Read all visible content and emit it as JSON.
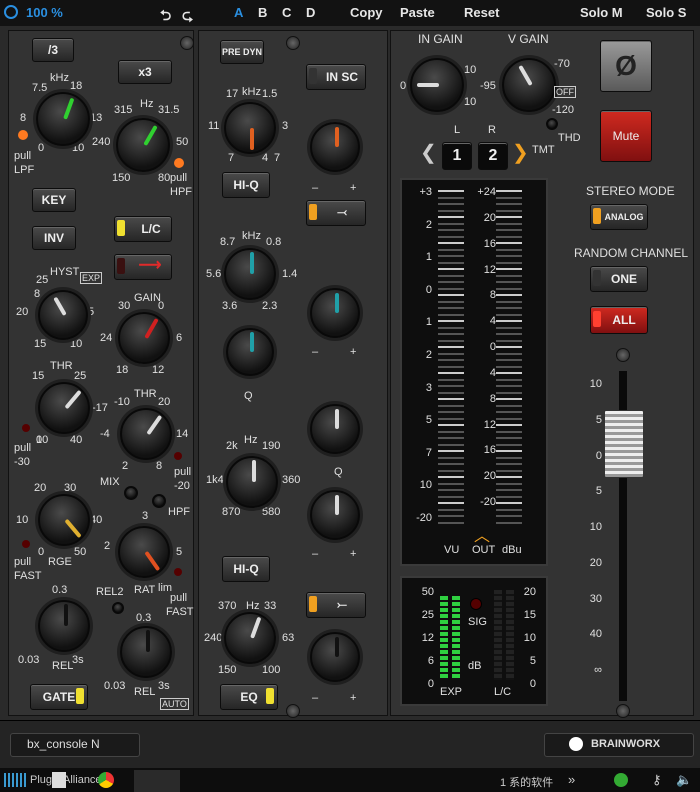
{
  "topbar": {
    "zoom": "100 %",
    "undo_icon": "undo-icon",
    "redo_icon": "redo-icon",
    "slot_a": "A",
    "slot_b": "B",
    "slot_c": "C",
    "slot_d": "D",
    "copy": "Copy",
    "paste": "Paste",
    "reset": "Reset",
    "solo_m": "Solo M",
    "solo_s": "Solo S"
  },
  "filter": {
    "div3": "/3",
    "x3": "x3",
    "lpf_unit": "kHz",
    "lpf_s1": "7.5",
    "lpf_s2": "18",
    "lpf_s3": "13",
    "lpf_s4": "8",
    "lpf_s5": "0",
    "lpf_s6": "10",
    "lpf_pull": "pull",
    "lpf_name": "LPF",
    "hpf_unit": "Hz",
    "hpf_s1": "315",
    "hpf_s2": "31.5",
    "hpf_s3": "240",
    "hpf_s4": "50",
    "hpf_s5": "150",
    "hpf_s6": "80",
    "hpf_pull": "pull",
    "hpf_name": "HPF"
  },
  "dyn": {
    "key": "KEY",
    "inv": "INV",
    "lc": "L/C",
    "hyst": "HYST",
    "exp": "EXP",
    "hyst_s": [
      "25",
      "8",
      "20",
      "5",
      "15",
      "10"
    ],
    "gain": "GAIN",
    "gain_s": [
      "30",
      "0",
      "24",
      "6",
      "18",
      "12"
    ],
    "thr1": "THR",
    "thr1_s": [
      "15",
      "25",
      "-17",
      "10",
      "0",
      "40"
    ],
    "thr1_pull": "pull",
    "thr1_val": "-30",
    "thr2": "THR",
    "thr2_s": [
      "-10",
      "20",
      "-4",
      "14",
      "2",
      "8"
    ],
    "thr2_pull": "pull",
    "thr2_val": "-20",
    "mix": "MIX",
    "hpf": "HPF",
    "rge": "RGE",
    "rge_s": [
      "20",
      "30",
      "10",
      "40",
      "0",
      "50"
    ],
    "rge_pull": "pull",
    "rge_fast": "FAST",
    "rat": "RAT",
    "rat_s": [
      "3",
      "2",
      "5",
      "lim"
    ],
    "rat_pull": "pull",
    "rat_fast": "FAST",
    "rel2": "REL2",
    "rel1": "REL",
    "rel1_s": [
      "0.3",
      "0.03",
      "3s"
    ],
    "rel2k": "REL",
    "rel2k_s": [
      "0.3",
      "0.03",
      "3s"
    ],
    "gate": "GATE",
    "auto": "AUTO"
  },
  "eq": {
    "pre_dyn": "PRE DYN",
    "in_sc": "IN SC",
    "hf_unit": "kHz",
    "hf_s": [
      "17",
      "1.5",
      "11",
      "3",
      "7",
      "4",
      "7"
    ],
    "hiq1": "HI-Q",
    "hmf_unit": "kHz",
    "hmf_s": [
      "8.7",
      "0.8",
      "5.6",
      "1.4",
      "3.6",
      "2.3"
    ],
    "q": "Q",
    "q2": "Q",
    "lmf_unit": "Hz",
    "lmf_s": [
      "2k",
      "190",
      "1k4",
      "360",
      "870",
      "580"
    ],
    "hiq2": "HI-Q",
    "lf_unit": "Hz",
    "lf_s": [
      "370",
      "33",
      "240",
      "63",
      "150",
      "100"
    ],
    "eq": "EQ",
    "minus": "–",
    "plus": "+"
  },
  "master": {
    "in_gain": "IN GAIN",
    "in_s": [
      "0",
      "10",
      "10"
    ],
    "v_gain": "V GAIN",
    "v_s": [
      "-70",
      "-95",
      "-120"
    ],
    "off": "OFF",
    "thd": "THD",
    "tmt": "TMT",
    "l": "L",
    "r": "R",
    "ch1": "1",
    "ch2": "2",
    "phase_icon": "phase-invert-icon",
    "mute": "Mute",
    "stereo_mode": "STEREO MODE",
    "analog": "ANALOG",
    "random_channel": "RANDOM CHANNEL",
    "one": "ONE",
    "all": "ALL",
    "vu_left": [
      "+3",
      "2",
      "1",
      "0",
      "1",
      "2",
      "3",
      "5",
      "7",
      "10",
      "-20"
    ],
    "vu_right": [
      "+24",
      "20",
      "16",
      "12",
      "8",
      "4",
      "0",
      "4",
      "8",
      "12",
      "16",
      "20",
      "-20"
    ],
    "vu": "VU",
    "out": "OUT",
    "dbu": "dBu",
    "exp_scale": [
      "50",
      "25",
      "12",
      "6",
      "0"
    ],
    "lc_scale": [
      "20",
      "15",
      "10",
      "5",
      "0"
    ],
    "sig": "SIG",
    "db": "dB",
    "exp": "EXP",
    "lc": "L/C",
    "fader_scale": [
      "10",
      "5",
      "0",
      "5",
      "10",
      "20",
      "30",
      "40",
      "∞"
    ]
  },
  "footer": {
    "model": "bx_console N",
    "brand": "BRAINWORX"
  },
  "taskbar": {
    "app": "Plugin Alliance",
    "cjk": "1 系的软件",
    "chev": "»"
  },
  "colors": {
    "accent_blue": "#2a8fe0",
    "mute_red": "#c0201a",
    "led_yellow": "#f0e030",
    "meter_green": "#2fd040"
  }
}
